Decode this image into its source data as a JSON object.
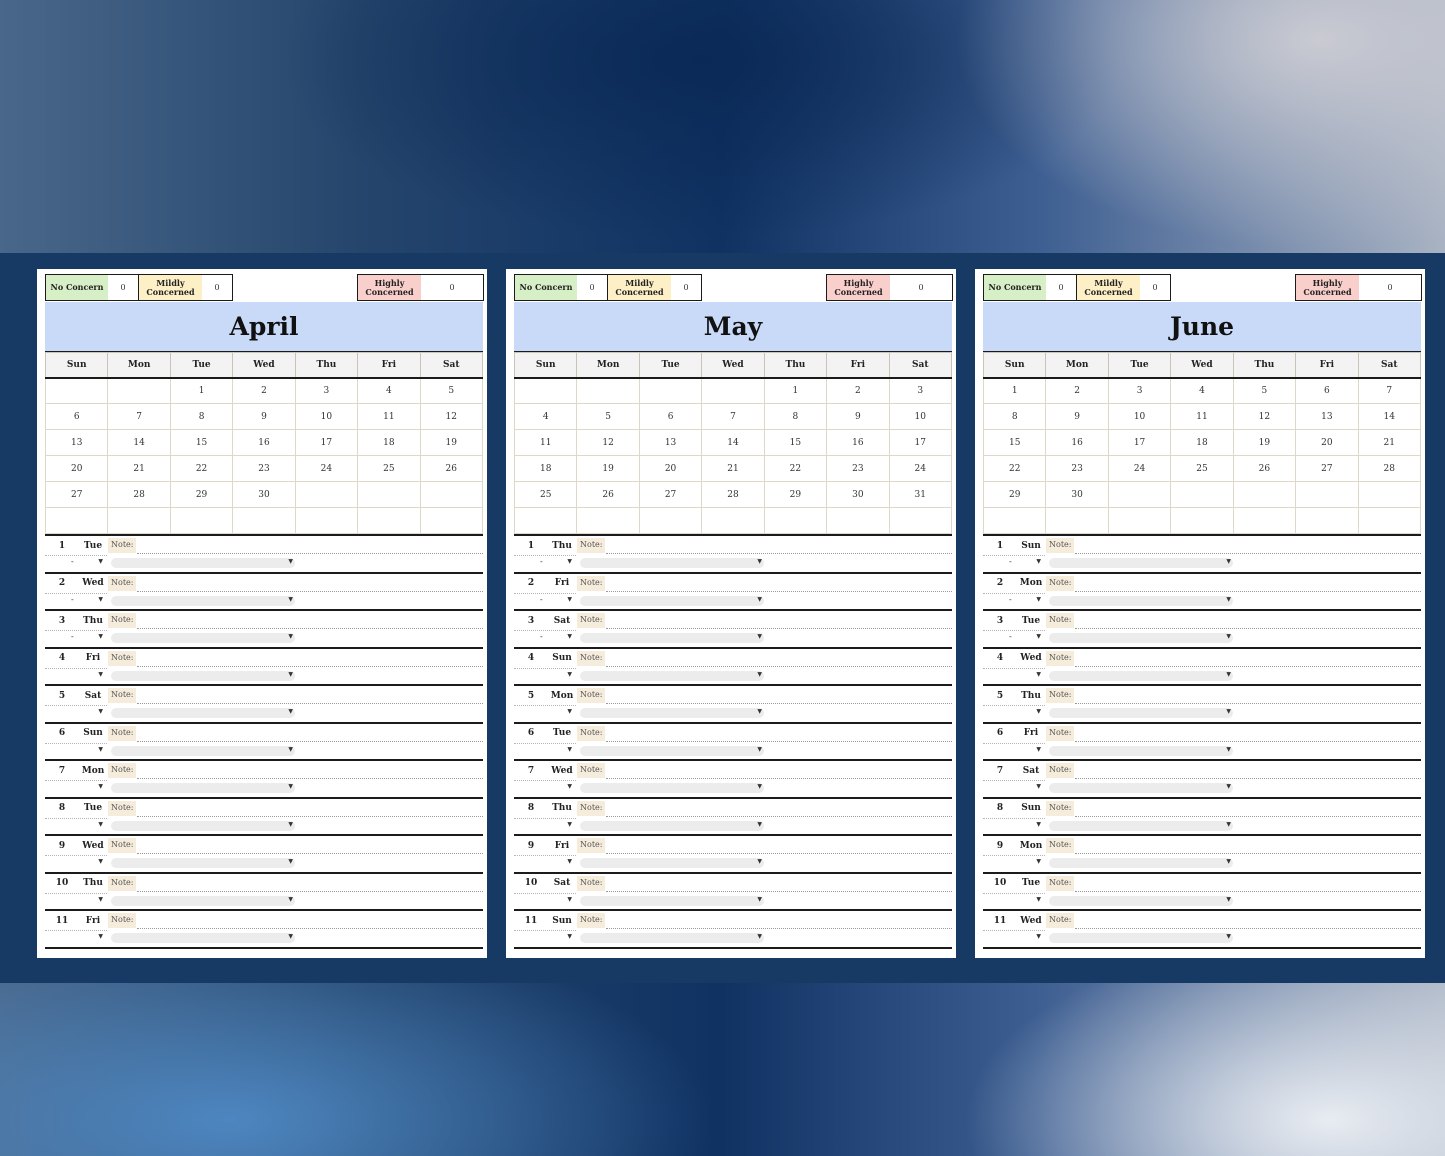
{
  "legend": {
    "no_concern": "No Concern",
    "mildly": "Mildly Concerned",
    "highly": "Highly Concerned",
    "arrow": "▼"
  },
  "weekday_headers": [
    "Sun",
    "Mon",
    "Tue",
    "Wed",
    "Thu",
    "Fri",
    "Sat"
  ],
  "note_label": "Note:",
  "months": [
    {
      "name": "April",
      "counts": {
        "no_concern": "0",
        "mildly": "0",
        "highly": "0"
      },
      "calendar": [
        [
          "",
          "",
          "1",
          "2",
          "3",
          "4",
          "5"
        ],
        [
          "6",
          "7",
          "8",
          "9",
          "10",
          "11",
          "12"
        ],
        [
          "13",
          "14",
          "15",
          "16",
          "17",
          "18",
          "19"
        ],
        [
          "20",
          "21",
          "22",
          "23",
          "24",
          "25",
          "26"
        ],
        [
          "27",
          "28",
          "29",
          "30",
          "",
          "",
          ""
        ],
        [
          "",
          "",
          "",
          "",
          "",
          "",
          ""
        ]
      ],
      "days": [
        {
          "num": "1",
          "weekday": "Tue",
          "status": "-"
        },
        {
          "num": "2",
          "weekday": "Wed",
          "status": "-"
        },
        {
          "num": "3",
          "weekday": "Thu",
          "status": "-"
        },
        {
          "num": "4",
          "weekday": "Fri",
          "status": ""
        },
        {
          "num": "5",
          "weekday": "Sat",
          "status": ""
        },
        {
          "num": "6",
          "weekday": "Sun",
          "status": ""
        },
        {
          "num": "7",
          "weekday": "Mon",
          "status": ""
        },
        {
          "num": "8",
          "weekday": "Tue",
          "status": ""
        },
        {
          "num": "9",
          "weekday": "Wed",
          "status": ""
        },
        {
          "num": "10",
          "weekday": "Thu",
          "status": ""
        },
        {
          "num": "11",
          "weekday": "Fri",
          "status": ""
        }
      ]
    },
    {
      "name": "May",
      "counts": {
        "no_concern": "0",
        "mildly": "0",
        "highly": "0"
      },
      "calendar": [
        [
          "",
          "",
          "",
          "",
          "1",
          "2",
          "3"
        ],
        [
          "4",
          "5",
          "6",
          "7",
          "8",
          "9",
          "10"
        ],
        [
          "11",
          "12",
          "13",
          "14",
          "15",
          "16",
          "17"
        ],
        [
          "18",
          "19",
          "20",
          "21",
          "22",
          "23",
          "24"
        ],
        [
          "25",
          "26",
          "27",
          "28",
          "29",
          "30",
          "31"
        ],
        [
          "",
          "",
          "",
          "",
          "",
          "",
          ""
        ]
      ],
      "days": [
        {
          "num": "1",
          "weekday": "Thu",
          "status": "-"
        },
        {
          "num": "2",
          "weekday": "Fri",
          "status": "-"
        },
        {
          "num": "3",
          "weekday": "Sat",
          "status": "-"
        },
        {
          "num": "4",
          "weekday": "Sun",
          "status": ""
        },
        {
          "num": "5",
          "weekday": "Mon",
          "status": ""
        },
        {
          "num": "6",
          "weekday": "Tue",
          "status": ""
        },
        {
          "num": "7",
          "weekday": "Wed",
          "status": ""
        },
        {
          "num": "8",
          "weekday": "Thu",
          "status": ""
        },
        {
          "num": "9",
          "weekday": "Fri",
          "status": ""
        },
        {
          "num": "10",
          "weekday": "Sat",
          "status": ""
        },
        {
          "num": "11",
          "weekday": "Sun",
          "status": ""
        }
      ]
    },
    {
      "name": "June",
      "counts": {
        "no_concern": "0",
        "mildly": "0",
        "highly": "0"
      },
      "calendar": [
        [
          "1",
          "2",
          "3",
          "4",
          "5",
          "6",
          "7"
        ],
        [
          "8",
          "9",
          "10",
          "11",
          "12",
          "13",
          "14"
        ],
        [
          "15",
          "16",
          "17",
          "18",
          "19",
          "20",
          "21"
        ],
        [
          "22",
          "23",
          "24",
          "25",
          "26",
          "27",
          "28"
        ],
        [
          "29",
          "30",
          "",
          "",
          "",
          "",
          ""
        ],
        [
          "",
          "",
          "",
          "",
          "",
          "",
          ""
        ]
      ],
      "days": [
        {
          "num": "1",
          "weekday": "Sun",
          "status": "-"
        },
        {
          "num": "2",
          "weekday": "Mon",
          "status": "-"
        },
        {
          "num": "3",
          "weekday": "Tue",
          "status": "-"
        },
        {
          "num": "4",
          "weekday": "Wed",
          "status": ""
        },
        {
          "num": "5",
          "weekday": "Thu",
          "status": ""
        },
        {
          "num": "6",
          "weekday": "Fri",
          "status": ""
        },
        {
          "num": "7",
          "weekday": "Sat",
          "status": ""
        },
        {
          "num": "8",
          "weekday": "Sun",
          "status": ""
        },
        {
          "num": "9",
          "weekday": "Mon",
          "status": ""
        },
        {
          "num": "10",
          "weekday": "Tue",
          "status": ""
        },
        {
          "num": "11",
          "weekday": "Wed",
          "status": ""
        }
      ]
    }
  ]
}
